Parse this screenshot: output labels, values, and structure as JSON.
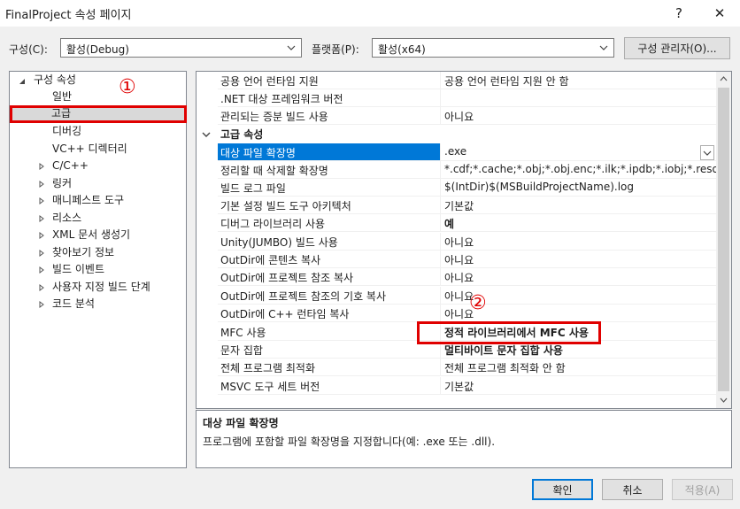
{
  "window": {
    "title": "FinalProject 속성 페이지",
    "help": "?",
    "close": "✕"
  },
  "toolbar": {
    "config_label": "구성(C):",
    "config_value": "활성(Debug)",
    "platform_label": "플랫폼(P):",
    "platform_value": "활성(x64)",
    "config_manager": "구성 관리자(O)..."
  },
  "tree": {
    "root": "구성 속성",
    "items": [
      "일반",
      "고급",
      "디버깅",
      "VC++ 디렉터리",
      "C/C++",
      "링커",
      "매니페스트 도구",
      "리소스",
      "XML 문서 생성기",
      "찾아보기 정보",
      "빌드 이벤트",
      "사용자 지정 빌드 단계",
      "코드 분석"
    ]
  },
  "grid": {
    "rows": [
      {
        "name": "공용 언어 런타임 지원",
        "value": "공용 언어 런타임 지원 안 함"
      },
      {
        "name": ".NET 대상 프레임워크 버전",
        "value": ""
      },
      {
        "name": "관리되는 증분 빌드 사용",
        "value": "아니요"
      }
    ],
    "section": "고급 속성",
    "adv_rows": [
      {
        "name": "대상 파일 확장명",
        "value": ".exe"
      },
      {
        "name": "정리할 때 삭제할 확장명",
        "value": "*.cdf;*.cache;*.obj;*.obj.enc;*.ilk;*.ipdb;*.iobj;*.resources;*.tlb;"
      },
      {
        "name": "빌드 로그 파일",
        "value": "$(IntDir)$(MSBuildProjectName).log"
      },
      {
        "name": "기본 설정 빌드 도구 아키텍처",
        "value": "기본값"
      },
      {
        "name": "디버그 라이브러리 사용",
        "value": "예"
      },
      {
        "name": "Unity(JUMBO) 빌드 사용",
        "value": "아니요"
      },
      {
        "name": "OutDir에 콘텐츠 복사",
        "value": "아니요"
      },
      {
        "name": "OutDir에 프로젝트 참조 복사",
        "value": "아니요"
      },
      {
        "name": "OutDir에 프로젝트 참조의 기호 복사",
        "value": "아니요"
      },
      {
        "name": "OutDir에 C++ 런타임 복사",
        "value": "아니요"
      },
      {
        "name": "MFC 사용",
        "value": "정적 라이브러리에서 MFC 사용"
      },
      {
        "name": "문자 집합",
        "value": "멀티바이트 문자 집합 사용"
      },
      {
        "name": "전체 프로그램 최적화",
        "value": "전체 프로그램 최적화 안 함"
      },
      {
        "name": "MSVC 도구 세트 버전",
        "value": "기본값"
      }
    ]
  },
  "description": {
    "title": "대상 파일 확장명",
    "text": "프로그램에 포함할 파일 확장명을 지정합니다(예: .exe 또는 .dll)."
  },
  "buttons": {
    "ok": "확인",
    "cancel": "취소",
    "apply": "적용(A)"
  },
  "annotations": {
    "one": "①",
    "two": "②"
  },
  "colors": {
    "selection": "#0078d7",
    "annotation_red": "#e00000"
  }
}
